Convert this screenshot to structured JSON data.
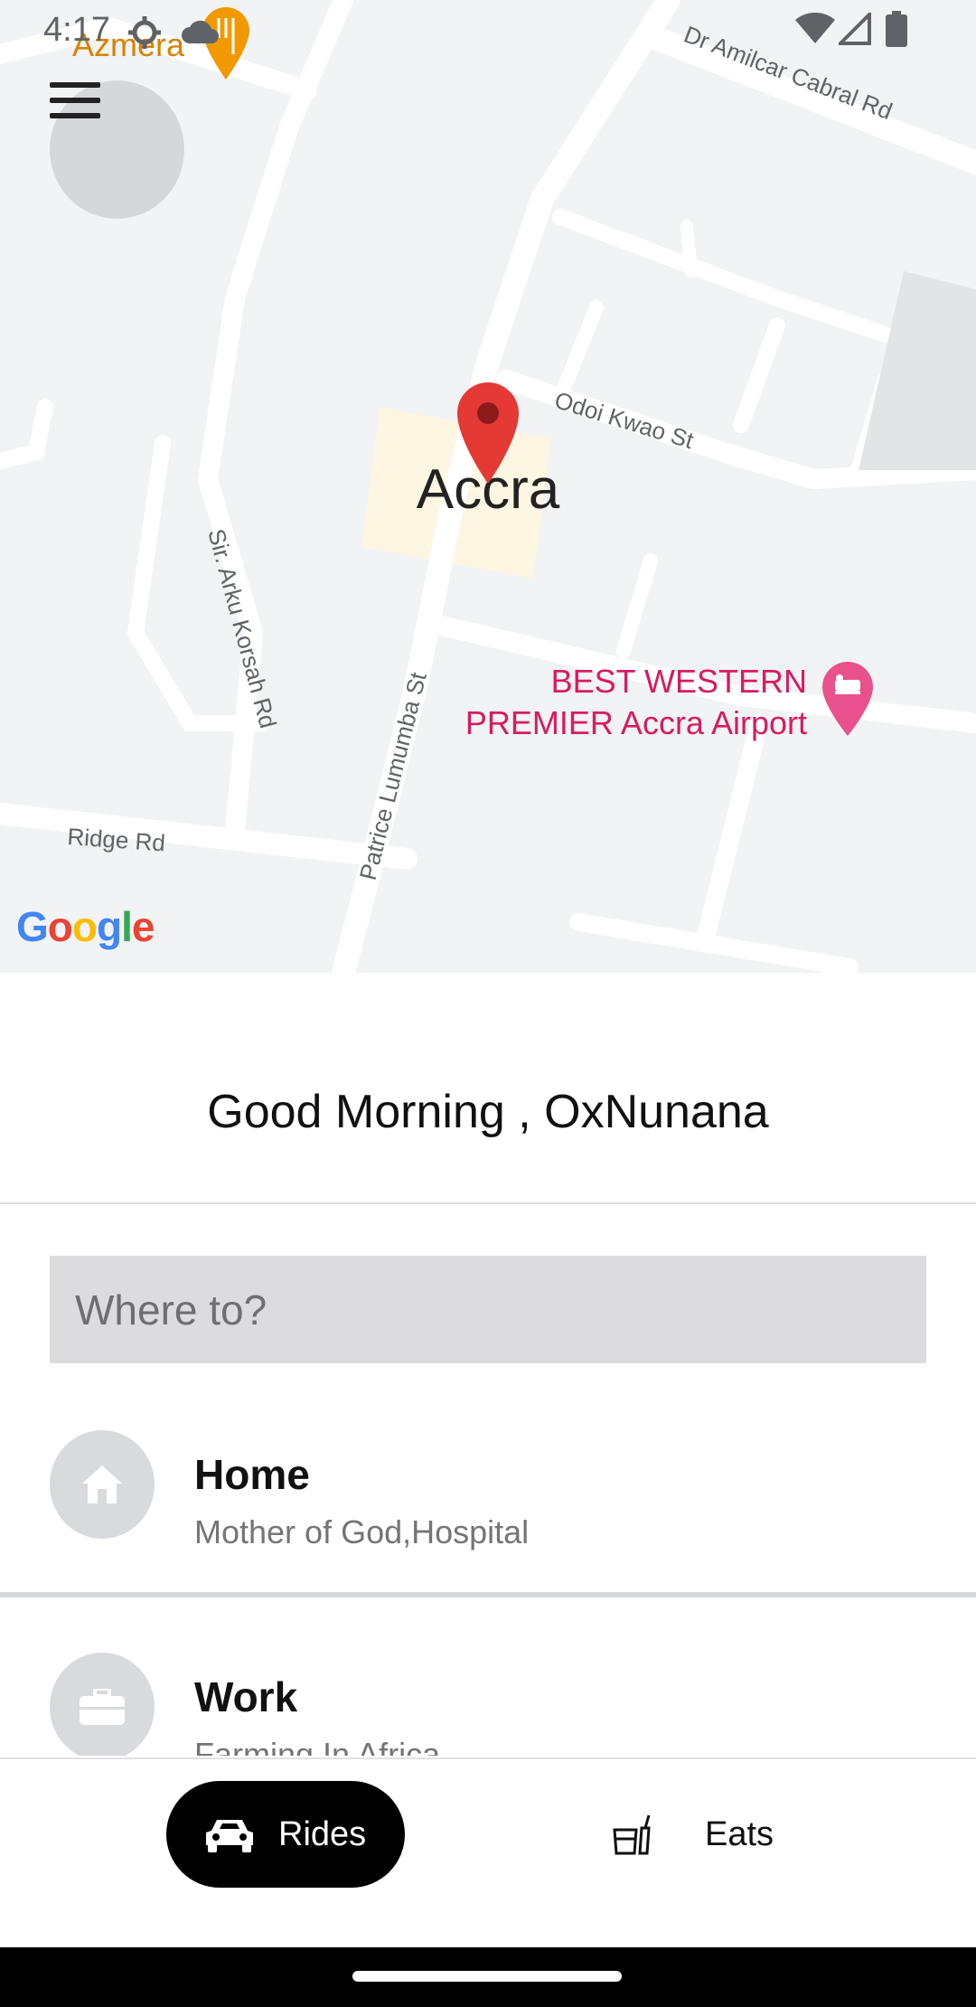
{
  "status_bar": {
    "time": "4:17"
  },
  "map": {
    "city_label": "Accra",
    "roads": [
      "Dr Amilcar Cabral Rd",
      "Odoi Kwao St",
      "Sir. Arku Korsah Rd",
      "Patrice Lumumba St",
      "Ridge Rd"
    ],
    "poi_azmera": "Azmera",
    "poi_hotel_line1": "BEST WESTERN",
    "poi_hotel_line2": "PREMIER Accra Airport",
    "attribution": "Google"
  },
  "greeting": "Good Morning , OxNunana",
  "search": {
    "placeholder": "Where to?"
  },
  "saved_places": [
    {
      "icon": "home-icon",
      "title": "Home",
      "subtitle": "Mother of God,Hospital"
    },
    {
      "icon": "briefcase-icon",
      "title": "Work",
      "subtitle": "Farming In Africa"
    }
  ],
  "bottom_tabs": [
    {
      "icon": "car-icon",
      "label": "Rides",
      "active": true
    },
    {
      "icon": "food-icon",
      "label": "Eats",
      "active": false
    }
  ],
  "colors": {
    "pin": "#e53935",
    "poi_hotel": "#d81b60",
    "poi_food": "#f29900",
    "active_tab_bg": "#000000"
  }
}
